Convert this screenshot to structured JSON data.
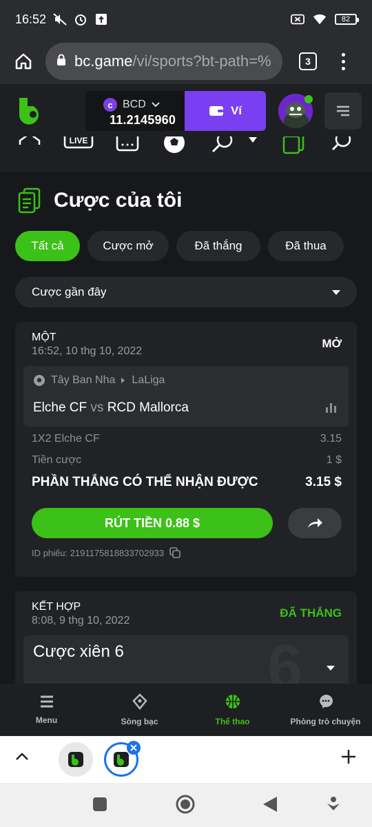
{
  "statusbar": {
    "time": "16:52",
    "battery": "82"
  },
  "browser": {
    "url_host": "bc.game",
    "url_path": "/vi/sports?bt-path=%",
    "tab_count": "3"
  },
  "header": {
    "currency": "BCD",
    "balance": "11.2145960",
    "wallet_label": "Ví"
  },
  "page": {
    "title": "Cược của tôi",
    "filters": [
      "Tất cả",
      "Cược mở",
      "Đã thắng",
      "Đã thua"
    ],
    "recent_select": "Cược gần đây"
  },
  "bet1": {
    "type": "MỘT",
    "date": "16:52, 10 thg 10, 2022",
    "status": "MỞ",
    "country": "Tây Ban Nha",
    "league": "LaLiga",
    "home": "Elche CF",
    "vs": "vs",
    "away": "RCD Mallorca",
    "market": "1X2 Elche CF",
    "odds": "3.15",
    "stake_label": "Tiền cược",
    "stake": "1 $",
    "payout_label": "PHẦN THẮNG CÓ THỂ NHẬN ĐƯỢC",
    "payout": "3.15 $",
    "cashout_label": "RÚT TIỀN 0.88 $",
    "ticket_id": "ID phiếu: 2191175818833702933"
  },
  "bet2": {
    "type": "KẾT HỢP",
    "date": "8:08, 9 thg 10, 2022",
    "status": "ĐÃ THẮNG",
    "title": "Cược xiên 6",
    "big_number": "6"
  },
  "bottom_nav": [
    "Menu",
    "Sòng bạc",
    "Thể thao",
    "Phòng trò chuyện"
  ],
  "colors": {
    "accent": "#3bc117",
    "wallet": "#7a3ff0",
    "bg": "#17181b",
    "card": "#212226"
  }
}
